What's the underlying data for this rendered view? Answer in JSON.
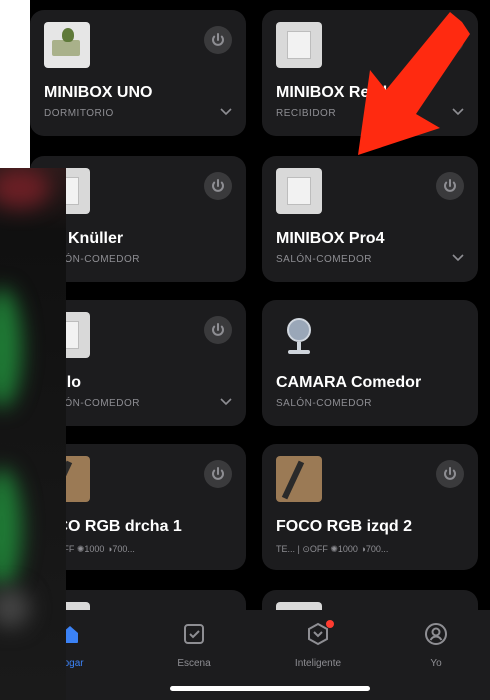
{
  "devices": [
    {
      "name": "MINIBOX UNO",
      "room": "DORMITORIO",
      "thumb": "switch-plant"
    },
    {
      "name": "MINIBOX Recibidor",
      "room": "RECIBIDOR",
      "thumb": "switch"
    },
    {
      "name": "go Knüller",
      "room": "SALÓN-COMEDOR",
      "thumb": "switch"
    },
    {
      "name": "MINIBOX Pro4",
      "room": "SALÓN-COMEDOR",
      "thumb": "switch"
    },
    {
      "name": "Tollo",
      "room": "SALÓN-COMEDOR",
      "thumb": "switch"
    },
    {
      "name": "CAMARA Comedor",
      "room": "SALÓN-COMEDOR",
      "thumb": "camera"
    },
    {
      "name": "OCO RGB drcha 1",
      "room": "",
      "stats": "| ⊙OFF ✺1000 ◑700...",
      "thumb": "lamp"
    },
    {
      "name": "FOCO RGB izqd 2",
      "room": "",
      "stats": "TE... | ⊙OFF ✺1000 ◑700...",
      "thumb": "lamp"
    }
  ],
  "tabs": [
    {
      "label": "Hogar",
      "icon": "home-icon",
      "active": true
    },
    {
      "label": "Escena",
      "icon": "scene-icon",
      "active": false
    },
    {
      "label": "Inteligente",
      "icon": "smart-icon",
      "active": false,
      "badge": true
    },
    {
      "label": "Yo",
      "icon": "profile-icon",
      "active": false
    }
  ],
  "colors": {
    "accent": "#3b82f6",
    "card": "#1c1c1e",
    "arrow": "#ff2a10",
    "badge": "#ff3b30"
  }
}
